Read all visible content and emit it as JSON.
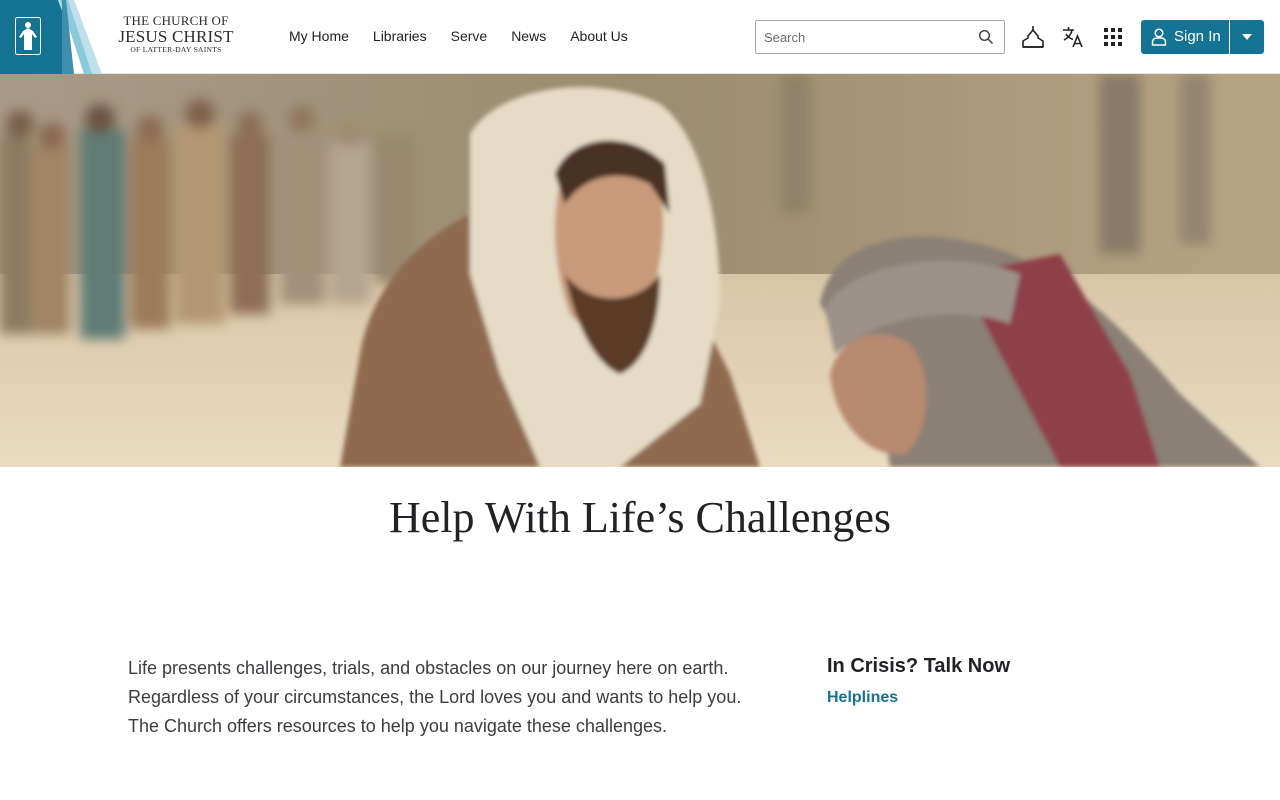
{
  "header": {
    "logo": {
      "line1": "THE CHURCH OF",
      "line2": "JESUS CHRIST",
      "line3": "OF LATTER-DAY SAINTS",
      "icon": "christus-statue-icon"
    },
    "nav": [
      {
        "label": "My Home"
      },
      {
        "label": "Libraries"
      },
      {
        "label": "Serve"
      },
      {
        "label": "News"
      },
      {
        "label": "About Us"
      }
    ],
    "search": {
      "placeholder": "Search",
      "value": "",
      "icon": "search-icon"
    },
    "icons": [
      "meetinghouse-icon",
      "language-icon",
      "app-grid-icon"
    ],
    "sign_in": {
      "label": "Sign In",
      "icon": "user-icon",
      "dropdown_icon": "caret-down-icon"
    }
  },
  "main": {
    "title": "Help With Life’s Challenges",
    "intro": "Life presents challenges, trials, and obstacles on our journey here on earth. Regardless of your circumstances, the Lord loves you and wants to help you. The Church offers resources to help you navigate these challenges.",
    "crisis": {
      "title": "In Crisis? Talk Now",
      "link": "Helplines"
    }
  },
  "colors": {
    "brand_blue": "#157493",
    "text": "#212225"
  }
}
